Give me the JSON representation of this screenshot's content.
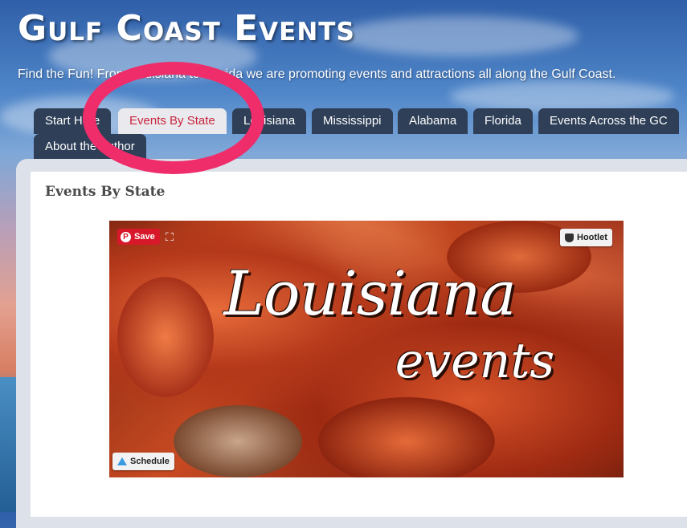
{
  "site": {
    "title": "Gulf Coast Events",
    "tagline": "Find the Fun! From Louisiana to Florida we are promoting events and attractions all along the Gulf Coast."
  },
  "nav": {
    "tabs": [
      {
        "label": "Start Here",
        "active": false
      },
      {
        "label": "Events By State",
        "active": true
      },
      {
        "label": "Louisiana",
        "active": false
      },
      {
        "label": "Mississippi",
        "active": false
      },
      {
        "label": "Alabama",
        "active": false
      },
      {
        "label": "Florida",
        "active": false
      },
      {
        "label": "Events Across the GC",
        "active": false
      },
      {
        "label": "About the Author",
        "active": false
      }
    ]
  },
  "page": {
    "heading": "Events By State"
  },
  "hero": {
    "title_line1": "Louisiana",
    "title_line2": "events"
  },
  "overlays": {
    "pinterest_save": "Save",
    "hootlet": "Hootlet",
    "schedule": "Schedule"
  },
  "colors": {
    "tab_bg": "#2e3f57",
    "active_tab_text": "#c8243b",
    "highlight_ring": "#ef2d6a",
    "pinterest_red": "#d7182a"
  },
  "icons": [
    "pinterest-icon",
    "expand-icon",
    "hootlet-owl-icon",
    "buffer-icon"
  ]
}
